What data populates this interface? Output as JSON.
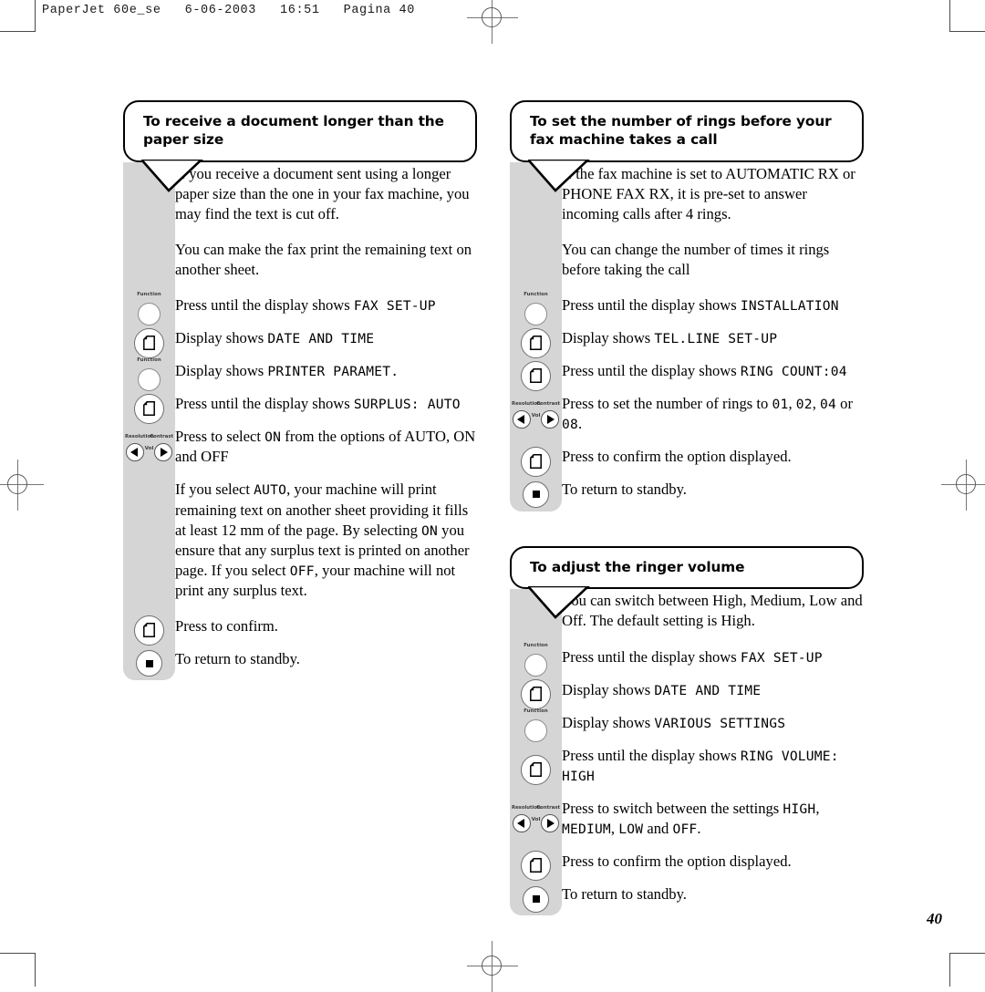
{
  "printer_slug": "PaperJet 60e_se   6-06-2003   16:51   Pagina 40",
  "page_number": "40",
  "icons": {
    "function_label": "Function",
    "resolution_label": "Resolution",
    "contrast_label": "Contrast",
    "vol_label": "Vol",
    "document_button": "document-button",
    "stop_button": "stop-button"
  },
  "sections": [
    {
      "id": "receive-longer-document",
      "column": "left",
      "heading": "To receive a document longer than the paper size",
      "rows": [
        {
          "button": "none",
          "parts": [
            {
              "t": "If you receive a document sent using a longer paper size than the one in your fax machine, you may find the text is cut off.",
              "lcd": false
            }
          ],
          "kind": "para"
        },
        {
          "button": "none",
          "parts": [
            {
              "t": "You can make the fax print the remaining text on another sheet.",
              "lcd": false
            }
          ],
          "kind": "para"
        },
        {
          "button": "function",
          "parts": [
            {
              "t": "Press until the display shows ",
              "lcd": false
            },
            {
              "t": "FAX SET-UP",
              "lcd": true
            }
          ],
          "kind": "step"
        },
        {
          "button": "document",
          "parts": [
            {
              "t": "Display shows ",
              "lcd": false
            },
            {
              "t": "DATE AND TIME",
              "lcd": true
            }
          ],
          "kind": "step"
        },
        {
          "button": "function",
          "parts": [
            {
              "t": "Display shows ",
              "lcd": false
            },
            {
              "t": "PRINTER PARAMET.",
              "lcd": true
            }
          ],
          "kind": "step"
        },
        {
          "button": "document",
          "parts": [
            {
              "t": "Press until the display shows ",
              "lcd": false
            },
            {
              "t": "SURPLUS: AUTO",
              "lcd": true
            }
          ],
          "kind": "step"
        },
        {
          "button": "arrows",
          "parts": [
            {
              "t": "Press to select ",
              "lcd": false
            },
            {
              "t": "ON",
              "lcd": true
            },
            {
              "t": " from the options of AUTO, ON and OFF",
              "lcd": false
            }
          ],
          "kind": "step"
        },
        {
          "button": "none",
          "parts": [
            {
              "t": "If you select ",
              "lcd": false
            },
            {
              "t": "AUTO",
              "lcd": true
            },
            {
              "t": ", your machine will print remaining text on another sheet providing it fills at least 12 mm of the page. By selecting ",
              "lcd": false
            },
            {
              "t": "ON",
              "lcd": true
            },
            {
              "t": " you ensure that any surplus text is printed on another page. If you select ",
              "lcd": false
            },
            {
              "t": "OFF",
              "lcd": true
            },
            {
              "t": ", your machine will not print any surplus text.",
              "lcd": false
            }
          ],
          "kind": "para"
        },
        {
          "button": "document",
          "parts": [
            {
              "t": "Press to confirm.",
              "lcd": false
            }
          ],
          "kind": "step"
        },
        {
          "button": "stop",
          "parts": [
            {
              "t": "To return to standby.",
              "lcd": false
            }
          ],
          "kind": "step"
        }
      ]
    },
    {
      "id": "set-number-of-rings",
      "column": "right",
      "heading": "To set the number of rings before your fax machine takes a call",
      "rows": [
        {
          "button": "none",
          "parts": [
            {
              "t": "If the fax machine is set to AUTOMATIC RX or PHONE FAX RX, it is pre-set to answer incoming calls after 4 rings.",
              "lcd": false
            }
          ],
          "kind": "para"
        },
        {
          "button": "none",
          "parts": [
            {
              "t": "You can change the number of times it rings before taking the call",
              "lcd": false
            }
          ],
          "kind": "para"
        },
        {
          "button": "function",
          "parts": [
            {
              "t": "Press until the display shows ",
              "lcd": false
            },
            {
              "t": "INSTALLATION",
              "lcd": true
            }
          ],
          "kind": "step"
        },
        {
          "button": "document",
          "parts": [
            {
              "t": "Display shows ",
              "lcd": false
            },
            {
              "t": "TEL.LINE SET-UP",
              "lcd": true
            }
          ],
          "kind": "step"
        },
        {
          "button": "document",
          "parts": [
            {
              "t": "Press until the display shows ",
              "lcd": false
            },
            {
              "t": "RING COUNT:04",
              "lcd": true
            }
          ],
          "kind": "step"
        },
        {
          "button": "arrows",
          "parts": [
            {
              "t": "Press to set the number of rings to ",
              "lcd": false
            },
            {
              "t": "01",
              "lcd": true
            },
            {
              "t": ", ",
              "lcd": false
            },
            {
              "t": "02",
              "lcd": true
            },
            {
              "t": ", ",
              "lcd": false
            },
            {
              "t": "04",
              "lcd": true
            },
            {
              "t": " or ",
              "lcd": false
            },
            {
              "t": "08",
              "lcd": true
            },
            {
              "t": ".",
              "lcd": false
            }
          ],
          "kind": "step"
        },
        {
          "button": "document",
          "parts": [
            {
              "t": "Press to confirm the option displayed.",
              "lcd": false
            }
          ],
          "kind": "step"
        },
        {
          "button": "stop",
          "parts": [
            {
              "t": "To return to standby.",
              "lcd": false
            }
          ],
          "kind": "step"
        }
      ]
    },
    {
      "id": "adjust-ringer-volume",
      "column": "right",
      "heading": "To adjust the ringer volume",
      "rows": [
        {
          "button": "none",
          "parts": [
            {
              "t": "You can switch between High, Medium, Low and Off. The default setting is High.",
              "lcd": false
            }
          ],
          "kind": "para"
        },
        {
          "button": "function",
          "parts": [
            {
              "t": "Press until the display shows ",
              "lcd": false
            },
            {
              "t": "FAX SET-UP",
              "lcd": true
            }
          ],
          "kind": "step"
        },
        {
          "button": "document",
          "parts": [
            {
              "t": "Display shows ",
              "lcd": false
            },
            {
              "t": "DATE AND TIME",
              "lcd": true
            }
          ],
          "kind": "step"
        },
        {
          "button": "function",
          "parts": [
            {
              "t": "Display shows ",
              "lcd": false
            },
            {
              "t": "VARIOUS SETTINGS",
              "lcd": true
            }
          ],
          "kind": "step"
        },
        {
          "button": "document",
          "parts": [
            {
              "t": "Press until the display shows ",
              "lcd": false
            },
            {
              "t": "RING VOLUME: HIGH",
              "lcd": true
            }
          ],
          "kind": "step"
        },
        {
          "button": "arrows",
          "parts": [
            {
              "t": "Press to switch between the settings ",
              "lcd": false
            },
            {
              "t": "HIGH",
              "lcd": true
            },
            {
              "t": ", ",
              "lcd": false
            },
            {
              "t": "MEDIUM",
              "lcd": true
            },
            {
              "t": ", ",
              "lcd": false
            },
            {
              "t": "LOW",
              "lcd": true
            },
            {
              "t": " and ",
              "lcd": false
            },
            {
              "t": "OFF",
              "lcd": true
            },
            {
              "t": ".",
              "lcd": false
            }
          ],
          "kind": "step"
        },
        {
          "button": "document",
          "parts": [
            {
              "t": "Press to confirm the option displayed.",
              "lcd": false
            }
          ],
          "kind": "step"
        },
        {
          "button": "stop",
          "parts": [
            {
              "t": "To return to standby.",
              "lcd": false
            }
          ],
          "kind": "step"
        }
      ]
    }
  ]
}
